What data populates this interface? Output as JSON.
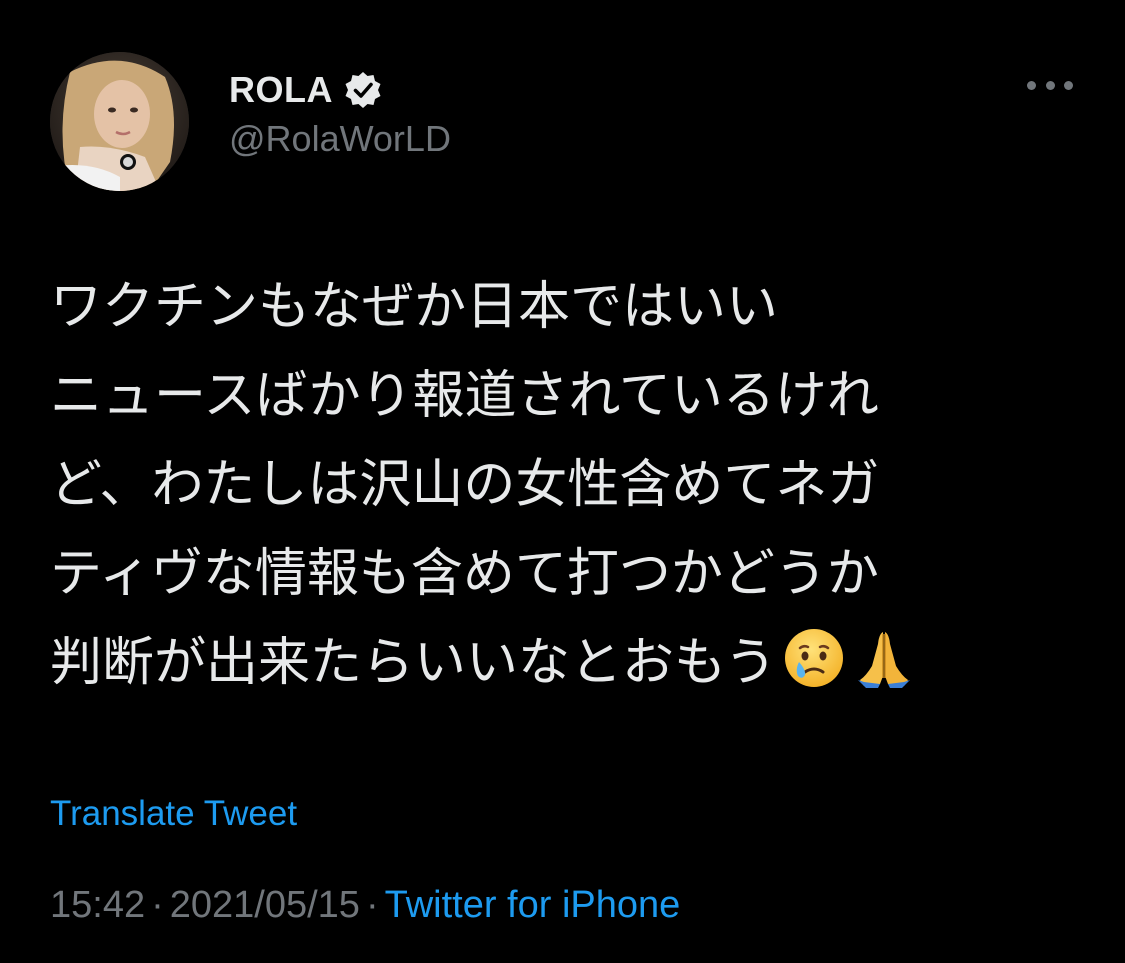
{
  "colors": {
    "background": "#000000",
    "text": "#e7e9ea",
    "secondary": "#71767b",
    "accent": "#1d9bf0"
  },
  "author": {
    "display_name": "ROLA",
    "handle": "@RolaWorLD",
    "verified": true,
    "avatar_icon": "profile-photo"
  },
  "more_menu_icon": "ellipsis-icon",
  "tweet": {
    "lines": [
      "ワクチンもなぜか日本ではいい",
      "ニュースばかり報道されているけれ",
      "ど、わたしは沢山の女性含めてネガ",
      "ティヴな情報も含めて打つかどうか",
      "判断が出来たらいいなとおもう"
    ],
    "emojis": [
      "crying-face-emoji",
      "folded-hands-emoji"
    ]
  },
  "translate_label": "Translate Tweet",
  "meta": {
    "time": "15:42",
    "separator": "·",
    "date": "2021/05/15",
    "source": "Twitter for iPhone"
  }
}
